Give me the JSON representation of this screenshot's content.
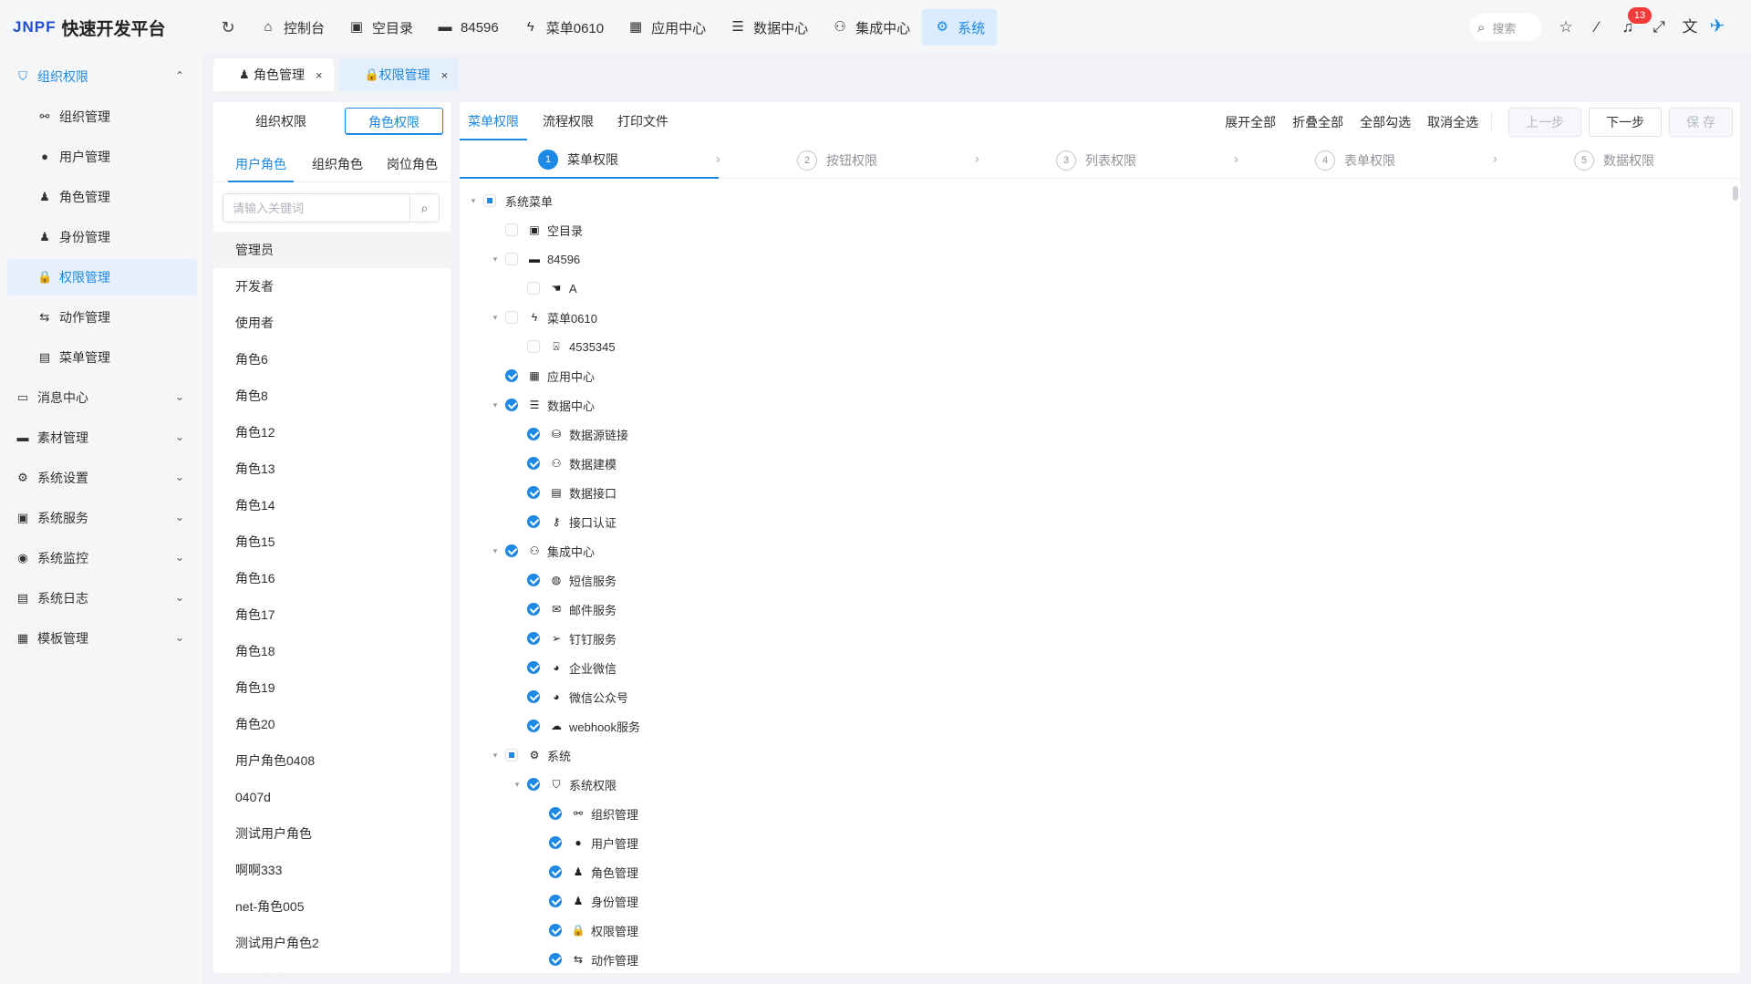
{
  "app": {
    "logo_text": "JNPF",
    "name": "快速开发平台"
  },
  "topnav": {
    "items": [
      {
        "label": "控制台",
        "icon": "home-icon",
        "glyph": "⌂"
      },
      {
        "label": "空目录",
        "icon": "gift-box-icon",
        "glyph": "▣"
      },
      {
        "label": "84596",
        "icon": "folder-icon",
        "glyph": "▬"
      },
      {
        "label": "菜单0610",
        "icon": "bolt-icon",
        "glyph": "ϟ"
      },
      {
        "label": "应用中心",
        "icon": "grid-icon",
        "glyph": "▦"
      },
      {
        "label": "数据中心",
        "icon": "server-icon",
        "glyph": "☰"
      },
      {
        "label": "集成中心",
        "icon": "nodes-icon",
        "glyph": "⚇"
      },
      {
        "label": "系统",
        "icon": "gear-icon",
        "glyph": "⚙"
      }
    ],
    "search_label": "搜索",
    "notification_count": "13"
  },
  "sidebar": {
    "items": [
      {
        "label": "组织权限",
        "level": "top",
        "icon": "shield-icon",
        "glyph": "⛉",
        "state": "open",
        "arrow": "⌃"
      },
      {
        "label": "组织管理",
        "level": "sub",
        "icon": "org-tree-icon",
        "glyph": "⚯"
      },
      {
        "label": "用户管理",
        "level": "sub",
        "icon": "user-icon",
        "glyph": "●"
      },
      {
        "label": "角色管理",
        "level": "sub",
        "icon": "role-icon",
        "glyph": "♟"
      },
      {
        "label": "身份管理",
        "level": "sub",
        "icon": "identity-icon",
        "glyph": "♟"
      },
      {
        "label": "权限管理",
        "level": "sub",
        "icon": "lock-icon",
        "glyph": "🔒",
        "state": "active"
      },
      {
        "label": "动作管理",
        "level": "sub",
        "icon": "action-icon",
        "glyph": "⇆"
      },
      {
        "label": "菜单管理",
        "level": "sub",
        "icon": "menu-icon",
        "glyph": "▤"
      },
      {
        "label": "消息中心",
        "level": "top",
        "icon": "message-icon",
        "glyph": "▭",
        "arrow": "⌄"
      },
      {
        "label": "素材管理",
        "level": "top",
        "icon": "folder-icon",
        "glyph": "▬",
        "arrow": "⌄"
      },
      {
        "label": "系统设置",
        "level": "top",
        "icon": "settings-icon",
        "glyph": "⚙",
        "arrow": "⌄"
      },
      {
        "label": "系统服务",
        "level": "top",
        "icon": "service-icon",
        "glyph": "▣",
        "arrow": "⌄"
      },
      {
        "label": "系统监控",
        "level": "top",
        "icon": "monitor-icon",
        "glyph": "◉",
        "arrow": "⌄"
      },
      {
        "label": "系统日志",
        "level": "top",
        "icon": "log-icon",
        "glyph": "▤",
        "arrow": "⌄"
      },
      {
        "label": "模板管理",
        "level": "top",
        "icon": "template-icon",
        "glyph": "▦",
        "arrow": "⌄"
      }
    ],
    "collapse_glyph": "«"
  },
  "tabs": [
    {
      "label": "角色管理",
      "active": false
    },
    {
      "label": "权限管理",
      "active": true
    }
  ],
  "role_panel": {
    "perm_switch": [
      "组织权限",
      "角色权限"
    ],
    "tabs": [
      "用户角色",
      "组织角色",
      "岗位角色"
    ],
    "search_placeholder": "请输入关键词",
    "roles": [
      "管理员",
      "开发者",
      "使用者",
      "角色6",
      "角色8",
      "角色12",
      "角色13",
      "角色14",
      "角色15",
      "角色16",
      "角色17",
      "角色18",
      "角色19",
      "角色20",
      "用户角色0408",
      "0407d",
      "测试用户角色",
      "啊啊333",
      "net-角色005",
      "测试用户角色2",
      "一一角色"
    ]
  },
  "main": {
    "tabs": [
      "菜单权限",
      "流程权限",
      "打印文件"
    ],
    "actions": [
      "展开全部",
      "折叠全部",
      "全部勾选",
      "取消全选"
    ],
    "buttons": {
      "prev": "上一步",
      "next": "下一步",
      "save": "保 存"
    },
    "steps": [
      {
        "num": "1",
        "label": "菜单权限"
      },
      {
        "num": "2",
        "label": "按钮权限"
      },
      {
        "num": "3",
        "label": "列表权限"
      },
      {
        "num": "4",
        "label": "表单权限"
      },
      {
        "num": "5",
        "label": "数据权限"
      }
    ],
    "tree": [
      {
        "label": "系统菜单",
        "depth": 0,
        "toggle": "▾",
        "check": "half",
        "icon": ""
      },
      {
        "label": "空目录",
        "depth": 1,
        "toggle": "",
        "check": "off",
        "icon": "gift-box-icon",
        "glyph": "▣"
      },
      {
        "label": "84596",
        "depth": 1,
        "toggle": "▾",
        "check": "off",
        "icon": "folder-icon",
        "glyph": "▬"
      },
      {
        "label": "A",
        "depth": 2,
        "toggle": "",
        "check": "off",
        "icon": "hand-icon",
        "glyph": "☚"
      },
      {
        "label": "菜单0610",
        "depth": 1,
        "toggle": "▾",
        "check": "off",
        "icon": "bolt-icon",
        "glyph": "ϟ"
      },
      {
        "label": "4535345",
        "depth": 2,
        "toggle": "",
        "check": "off",
        "icon": "robot-icon",
        "glyph": "⍓"
      },
      {
        "label": "应用中心",
        "depth": 1,
        "toggle": "",
        "check": "on",
        "icon": "grid-icon",
        "glyph": "▦"
      },
      {
        "label": "数据中心",
        "depth": 1,
        "toggle": "▾",
        "check": "on",
        "icon": "server-icon",
        "glyph": "☰"
      },
      {
        "label": "数据源链接",
        "depth": 2,
        "toggle": "",
        "check": "on",
        "icon": "database-icon",
        "glyph": "⛁"
      },
      {
        "label": "数据建模",
        "depth": 2,
        "toggle": "",
        "check": "on",
        "icon": "model-icon",
        "glyph": "⚇"
      },
      {
        "label": "数据接口",
        "depth": 2,
        "toggle": "",
        "check": "on",
        "icon": "api-icon",
        "glyph": "▤"
      },
      {
        "label": "接口认证",
        "depth": 2,
        "toggle": "",
        "check": "on",
        "icon": "key-icon",
        "glyph": "⚷"
      },
      {
        "label": "集成中心",
        "depth": 1,
        "toggle": "▾",
        "check": "on",
        "icon": "nodes-icon",
        "glyph": "⚇"
      },
      {
        "label": "短信服务",
        "depth": 2,
        "toggle": "",
        "check": "on",
        "icon": "sms-icon",
        "glyph": "◍"
      },
      {
        "label": "邮件服务",
        "depth": 2,
        "toggle": "",
        "check": "on",
        "icon": "mail-icon",
        "glyph": "✉"
      },
      {
        "label": "钉钉服务",
        "depth": 2,
        "toggle": "",
        "check": "on",
        "icon": "dingtalk-icon",
        "glyph": "➢"
      },
      {
        "label": "企业微信",
        "depth": 2,
        "toggle": "",
        "check": "on",
        "icon": "wework-icon",
        "glyph": "◕"
      },
      {
        "label": "微信公众号",
        "depth": 2,
        "toggle": "",
        "check": "on",
        "icon": "wechat-icon",
        "glyph": "◕"
      },
      {
        "label": "webhook服务",
        "depth": 2,
        "toggle": "",
        "check": "on",
        "icon": "webhook-icon",
        "glyph": "☁"
      },
      {
        "label": "系统",
        "depth": 1,
        "toggle": "▾",
        "check": "half",
        "icon": "gear-icon",
        "glyph": "⚙"
      },
      {
        "label": "系统权限",
        "depth": 2,
        "toggle": "▾",
        "check": "on",
        "icon": "shield-icon",
        "glyph": "⛉"
      },
      {
        "label": "组织管理",
        "depth": 3,
        "toggle": "",
        "check": "on",
        "icon": "org-tree-icon",
        "glyph": "⚯"
      },
      {
        "label": "用户管理",
        "depth": 3,
        "toggle": "",
        "check": "on",
        "icon": "user-icon",
        "glyph": "●"
      },
      {
        "label": "角色管理",
        "depth": 3,
        "toggle": "",
        "check": "on",
        "icon": "role-icon",
        "glyph": "♟"
      },
      {
        "label": "身份管理",
        "depth": 3,
        "toggle": "",
        "check": "on",
        "icon": "identity-icon",
        "glyph": "♟"
      },
      {
        "label": "权限管理",
        "depth": 3,
        "toggle": "",
        "check": "on",
        "icon": "lock-icon",
        "glyph": "🔒"
      },
      {
        "label": "动作管理",
        "depth": 3,
        "toggle": "",
        "check": "on",
        "icon": "action-icon",
        "glyph": "⇆"
      }
    ]
  }
}
